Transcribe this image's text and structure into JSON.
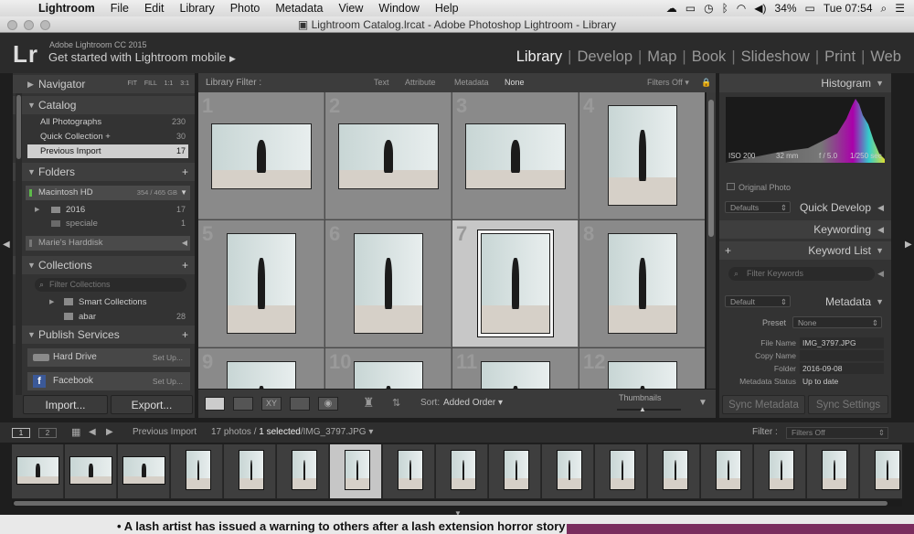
{
  "menubar": {
    "items": [
      "Lightroom",
      "File",
      "Edit",
      "Library",
      "Photo",
      "Metadata",
      "View",
      "Window",
      "Help"
    ],
    "battery": "34%",
    "clock": "Tue 07:54"
  },
  "window_title": "Lightroom Catalog.lrcat - Adobe Photoshop Lightroom - Library",
  "identity": {
    "logo": "Lr",
    "app_name": "Adobe Lightroom CC 2015",
    "mobile": "Get started with Lightroom mobile"
  },
  "modules": [
    "Library",
    "Develop",
    "Map",
    "Book",
    "Slideshow",
    "Print",
    "Web"
  ],
  "navigator": {
    "title": "Navigator",
    "zoom": [
      "FIT",
      "FILL",
      "1:1",
      "3:1"
    ]
  },
  "catalog": {
    "title": "Catalog",
    "items": [
      {
        "label": "All Photographs",
        "count": "230"
      },
      {
        "label": "Quick Collection +",
        "count": "30"
      },
      {
        "label": "Previous Import",
        "count": "17"
      }
    ]
  },
  "folders": {
    "title": "Folders",
    "volume": "Macintosh HD",
    "volume_size": "354 / 465 GB",
    "items": [
      {
        "label": "2016",
        "count": "17"
      },
      {
        "label": "speciale",
        "count": "1"
      }
    ],
    "volume2": "Marie's Harddisk"
  },
  "collections": {
    "title": "Collections",
    "filter_placeholder": "Filter Collections",
    "items": [
      {
        "label": "Smart Collections",
        "count": ""
      },
      {
        "label": "abar",
        "count": "28"
      }
    ]
  },
  "publish": {
    "title": "Publish Services",
    "items": [
      {
        "label": "Hard Drive",
        "action": "Set Up..."
      },
      {
        "label": "Facebook",
        "action": "Set Up..."
      }
    ]
  },
  "import_label": "Import...",
  "export_label": "Export...",
  "library_filter": {
    "label": "Library Filter :",
    "tabs": [
      "Text",
      "Attribute",
      "Metadata",
      "None"
    ],
    "state": "Filters Off"
  },
  "grid": {
    "numbers": [
      "1",
      "2",
      "3",
      "4",
      "5",
      "6",
      "7",
      "8",
      "9",
      "10",
      "11",
      "12"
    ],
    "selected_index": 6
  },
  "toolbar": {
    "sort_label": "Sort:",
    "sort_value": "Added Order",
    "thumbnails_label": "Thumbnails"
  },
  "histogram": {
    "title": "Histogram",
    "iso": "ISO 200",
    "focal": "32 mm",
    "aperture": "f / 5.0",
    "shutter": "1/250 sec",
    "original_photo": "Original Photo"
  },
  "quick_develop": {
    "title": "Quick Develop",
    "preset": "Defaults"
  },
  "keywording": {
    "title": "Keywording"
  },
  "keyword_list": {
    "title": "Keyword List",
    "filter_placeholder": "Filter Keywords"
  },
  "metadata": {
    "title": "Metadata",
    "preset_select": "Default",
    "preset_label": "Preset",
    "preset_value": "None",
    "fields": [
      {
        "label": "File Name",
        "value": "IMG_3797.JPG"
      },
      {
        "label": "Copy Name",
        "value": ""
      },
      {
        "label": "Folder",
        "value": "2016-09-08"
      },
      {
        "label": "Metadata Status",
        "value": "Up to date"
      }
    ]
  },
  "sync_metadata": "Sync Metadata",
  "sync_settings": "Sync Settings",
  "filmstrip_bar": {
    "pages": [
      "1",
      "2"
    ],
    "source": "Previous Import",
    "count": "17 photos /",
    "selected": "1 selected",
    "file": "/IMG_3797.JPG",
    "filter_label": "Filter :",
    "filter_value": "Filters Off"
  },
  "news_ticker": "A lash artist has issued a warning to others after a lash extension horror story"
}
